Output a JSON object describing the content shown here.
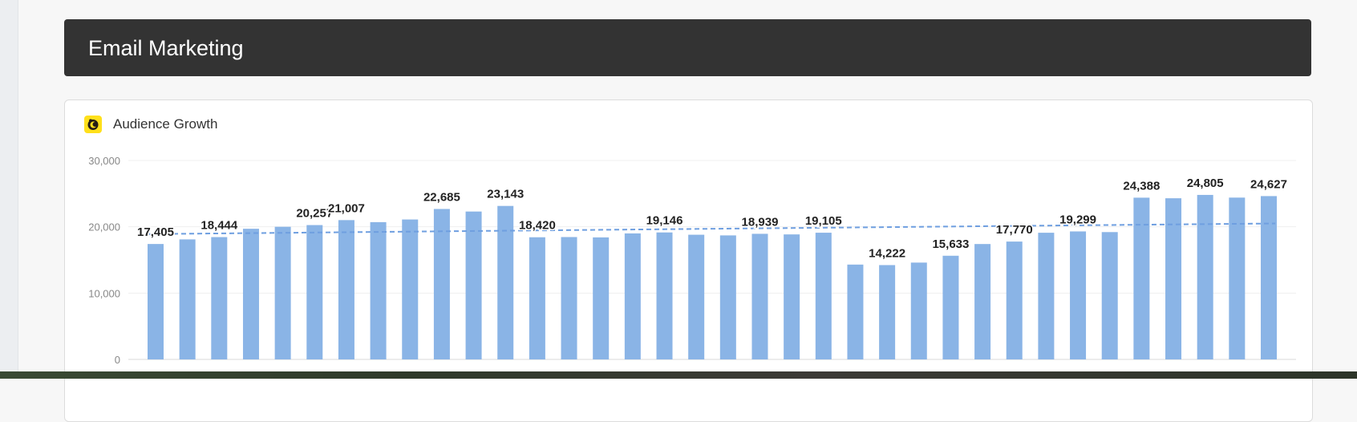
{
  "header": {
    "title": "Email Marketing"
  },
  "card": {
    "title": "Audience Growth",
    "logo_icon": "mailchimp-icon"
  },
  "colors": {
    "bar": "#8ab4e6",
    "trend": "#6f9fe0",
    "header_bg": "#333333",
    "logo_bg": "#ffe01b"
  },
  "chart_data": {
    "type": "bar",
    "title": "Audience Growth",
    "xlabel": "",
    "ylabel": "",
    "ylim": [
      0,
      30000
    ],
    "yticks": [
      0,
      10000,
      20000,
      30000
    ],
    "ytick_labels": [
      "0",
      "10,000",
      "20,000",
      "30,000"
    ],
    "grid": true,
    "trendline": {
      "style": "dashed",
      "start": 18900,
      "end": 20500
    },
    "values": [
      17405,
      18100,
      18444,
      19700,
      20000,
      20257,
      21007,
      20700,
      21100,
      22685,
      22300,
      23143,
      18420,
      18450,
      18400,
      19000,
      19146,
      18800,
      18700,
      18939,
      18850,
      19105,
      14300,
      14222,
      14600,
      15633,
      17400,
      17770,
      19100,
      19299,
      19200,
      24388,
      24300,
      24805,
      24400,
      24627
    ],
    "data_labels": [
      {
        "index": 0,
        "text": "17,405"
      },
      {
        "index": 2,
        "text": "18,444"
      },
      {
        "index": 5,
        "text": "20,257"
      },
      {
        "index": 6,
        "text": "21,007"
      },
      {
        "index": 9,
        "text": "22,685"
      },
      {
        "index": 11,
        "text": "23,143"
      },
      {
        "index": 12,
        "text": "18,420"
      },
      {
        "index": 16,
        "text": "19,146"
      },
      {
        "index": 19,
        "text": "18,939"
      },
      {
        "index": 21,
        "text": "19,105"
      },
      {
        "index": 23,
        "text": "14,222"
      },
      {
        "index": 25,
        "text": "15,633"
      },
      {
        "index": 27,
        "text": "17,770"
      },
      {
        "index": 29,
        "text": "19,299"
      },
      {
        "index": 31,
        "text": "24,388"
      },
      {
        "index": 33,
        "text": "24,805"
      },
      {
        "index": 35,
        "text": "24,627"
      }
    ]
  }
}
